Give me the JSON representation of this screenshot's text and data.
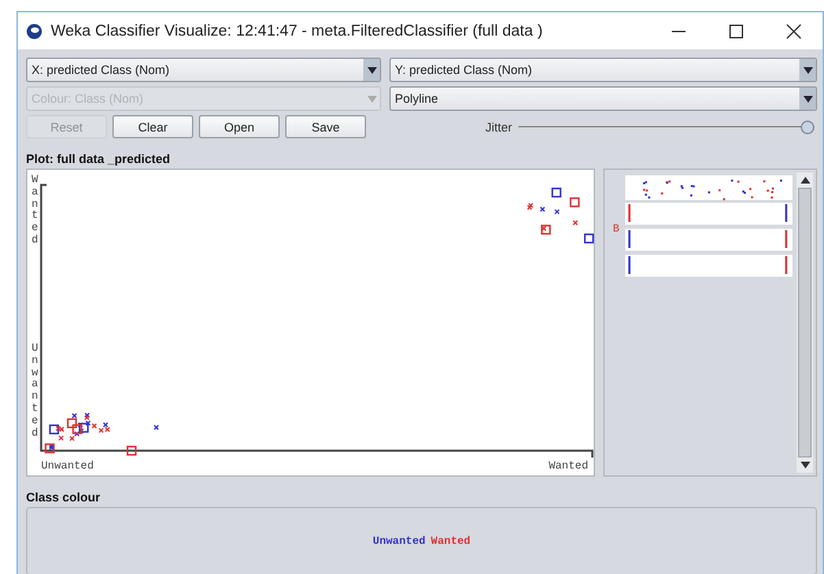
{
  "window": {
    "title": "Weka Classifier Visualize: 12:41:47 - meta.FilteredClassifier (full data )"
  },
  "selectors": [
    {
      "value": "X: predicted Class (Nom)",
      "disabled": false
    },
    {
      "value": "Y: predicted Class (Nom)",
      "disabled": false
    },
    {
      "value": "Colour: Class (Nom)",
      "disabled": true
    },
    {
      "value": "Polyline",
      "disabled": false
    }
  ],
  "buttons": [
    {
      "label": "Reset",
      "disabled": true
    },
    {
      "label": "Clear",
      "disabled": false
    },
    {
      "label": "Open",
      "disabled": false
    },
    {
      "label": "Save",
      "disabled": false
    }
  ],
  "jitter": {
    "label": "Jitter",
    "level": 1
  },
  "plot": {
    "title": "Plot: full data _predicted",
    "x_labels": [
      "Unwanted",
      "Wanted"
    ],
    "y_labels": [
      "Wanted",
      "Unwanted"
    ]
  },
  "attribute_panel": {
    "legend": "B"
  },
  "class_colour": {
    "title": "Class colour",
    "classes": [
      {
        "label": "Unwanted",
        "color": "#3333cc"
      },
      {
        "label": "Wanted",
        "color": "#e03030"
      }
    ]
  }
}
